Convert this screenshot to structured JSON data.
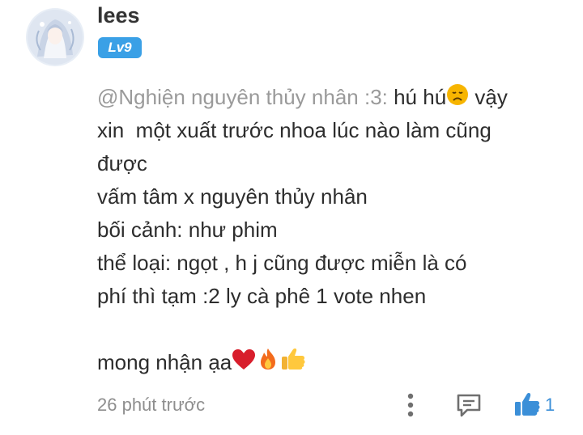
{
  "user": {
    "name": "lees",
    "level": "Lv9",
    "avatar_icon": "anime-avatar"
  },
  "comment": {
    "mention": "@Nghiện nguyên thủy nhân :3:",
    "line1_rest": " hú hú",
    "line1_after_emoji": " vậy",
    "line2": "xin  một xuất trước nhoa lúc nào làm cũng",
    "line3": "được",
    "line4": "vấm tâm x nguyên thủy nhân",
    "line5": "bối cảnh: như phim",
    "line6": "thể loại: ngọt , h j cũng được miễn là có",
    "line7": "phí thì tạm :2 ly cà phê 1 vote nhen",
    "line9": "mong nhận ạa",
    "emojis": [
      "disappointed-face",
      "red-heart",
      "fire",
      "thumbs-up"
    ]
  },
  "footer": {
    "timestamp": "26 phút trước",
    "like_count": "1",
    "accent_color": "#3b8fd8"
  }
}
